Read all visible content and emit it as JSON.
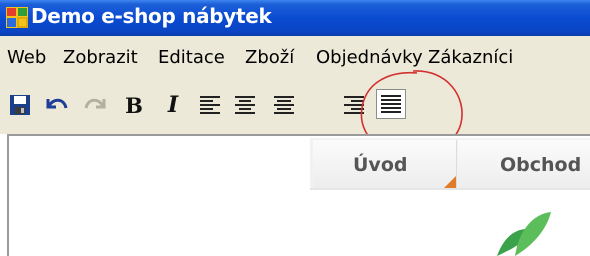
{
  "window": {
    "title": "Demo e-shop nábytek",
    "icon": "app-window-icon"
  },
  "menu": {
    "items": [
      "Web",
      "Zobrazit",
      "Editace",
      "Zboží",
      "Objednávky",
      "Zákazníci"
    ]
  },
  "toolbar": {
    "buttons": [
      {
        "name": "save-icon"
      },
      {
        "name": "undo-icon"
      },
      {
        "name": "redo-icon"
      },
      {
        "name": "bold-button",
        "label": "B"
      },
      {
        "name": "italic-button",
        "label": "I"
      },
      {
        "name": "align-left-icon"
      },
      {
        "name": "align-center-icon"
      },
      {
        "name": "align-right-icon"
      },
      {
        "name": "align-justify-icon",
        "state": "active"
      }
    ],
    "highlight_color": "#d33030"
  },
  "tabs": [
    {
      "label": "Úvod"
    },
    {
      "label": "Obchod"
    }
  ],
  "colors": {
    "titlebar": "#0a4bd1",
    "chrome": "#ece9d8",
    "tab_accent": "#e07b2a"
  }
}
